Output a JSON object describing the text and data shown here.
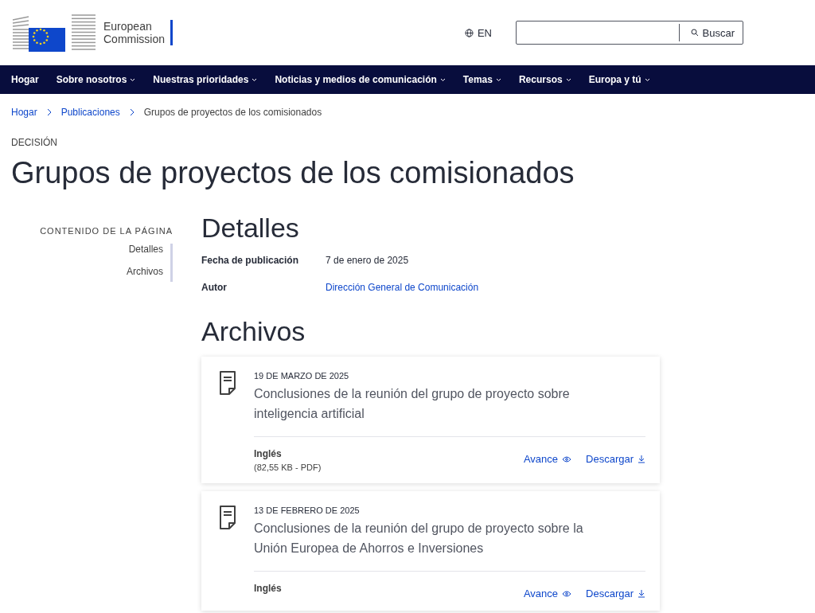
{
  "header": {
    "logo_text": [
      "European",
      "Commission"
    ],
    "language": "EN",
    "search": {
      "button": "Buscar"
    }
  },
  "nav": [
    "Hogar",
    "Sobre nosotros",
    "Nuestras prioridades",
    "Noticias y medios de comunicación",
    "Temas",
    "Recursos",
    "Europa y tú"
  ],
  "breadcrumb": [
    "Hogar",
    "Publicaciones",
    "Grupos de proyectos de los comisionados"
  ],
  "page_type": "DECISIÓN",
  "title": "Grupos de proyectos de los comisionados",
  "toc": {
    "heading": "CONTENIDO DE LA PÁGINA",
    "items": [
      "Detalles",
      "Archivos"
    ]
  },
  "details": {
    "heading": "Detalles",
    "rows": [
      {
        "label": "Fecha de publicación",
        "value": "7 de enero de 2025",
        "kind": "text"
      },
      {
        "label": "Autor",
        "value": "Dirección General de Comunicación",
        "kind": "link"
      }
    ]
  },
  "files": {
    "heading": "Archivos",
    "items": [
      {
        "date": "19 DE MARZO DE 2025",
        "title": "Conclusiones de la reunión del grupo de proyecto sobre inteligencia artificial",
        "language": "Inglés",
        "size": "(82,55 KB - PDF)",
        "preview": "Avance",
        "download": "Descargar"
      },
      {
        "date": "13 DE FEBRERO DE 2025",
        "title": "Conclusiones de la reunión del grupo de proyecto sobre la Unión Europea de Ahorros e Inversiones",
        "language": "Inglés",
        "preview": "Avance",
        "download": "Descargar"
      }
    ]
  }
}
